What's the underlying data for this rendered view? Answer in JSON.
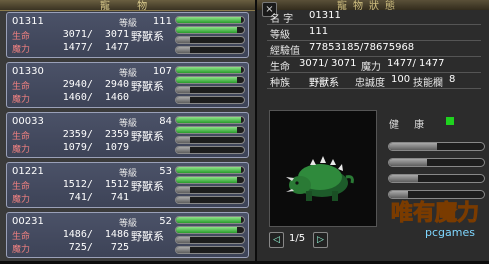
{
  "left": {
    "title": "寵 物",
    "pets": [
      {
        "id": "01311",
        "level_label": "等級",
        "level": "111",
        "hp_label": "生命",
        "mp_label": "魔力",
        "hp": "3071/  3071",
        "mp": "1477/  1477",
        "type": "野獸系",
        "bars": [
          0.95,
          0.9,
          0.2,
          0.2
        ]
      },
      {
        "id": "01330",
        "level_label": "等級",
        "level": "107",
        "hp_label": "生命",
        "mp_label": "魔力",
        "hp": "2940/  2940",
        "mp": "1460/  1460",
        "type": "野獸系",
        "bars": [
          0.95,
          0.9,
          0.2,
          0.2
        ]
      },
      {
        "id": "00033",
        "level_label": "等級",
        "level": "84",
        "hp_label": "生命",
        "mp_label": "魔力",
        "hp": "2359/  2359",
        "mp": "1079/  1079",
        "type": "野獸系",
        "bars": [
          0.95,
          0.9,
          0.2,
          0.2
        ]
      },
      {
        "id": "01221",
        "level_label": "等級",
        "level": "53",
        "hp_label": "生命",
        "mp_label": "魔力",
        "hp": "1512/  1512",
        "mp": " 741/   741",
        "type": "野獸系",
        "bars": [
          0.95,
          0.9,
          0.2,
          0.2
        ]
      },
      {
        "id": "00231",
        "level_label": "等級",
        "level": "52",
        "hp_label": "生命",
        "mp_label": "魔力",
        "hp": "1486/  1486",
        "mp": " 725/   725",
        "type": "野獸系",
        "bars": [
          0.95,
          0.9,
          0.2,
          0.2
        ]
      }
    ]
  },
  "right": {
    "title": "寵物狀態",
    "close": "×",
    "name_label": "名 字",
    "name": "01311",
    "level_label": "等級",
    "level": "111",
    "exp_label": "經驗值",
    "exp": "77853185/78675968",
    "hp_label": "生命",
    "hp": "3071/ 3071",
    "mp_label": "魔力",
    "mp": "1477/ 1477",
    "race_label": "种族",
    "race": "野獸系",
    "loyalty_label": "忠誠度",
    "loyalty": "100",
    "skill_label": "技能欄",
    "skill": "8",
    "health_label": "健 康",
    "health_color": "#1fd21f",
    "rbars": [
      0.5,
      0.4,
      0.3,
      0.2
    ],
    "pager": "1/5",
    "prev": "◁",
    "next": "▷",
    "logo_text": "唯有魔力",
    "logo_sub": "pcgames"
  }
}
